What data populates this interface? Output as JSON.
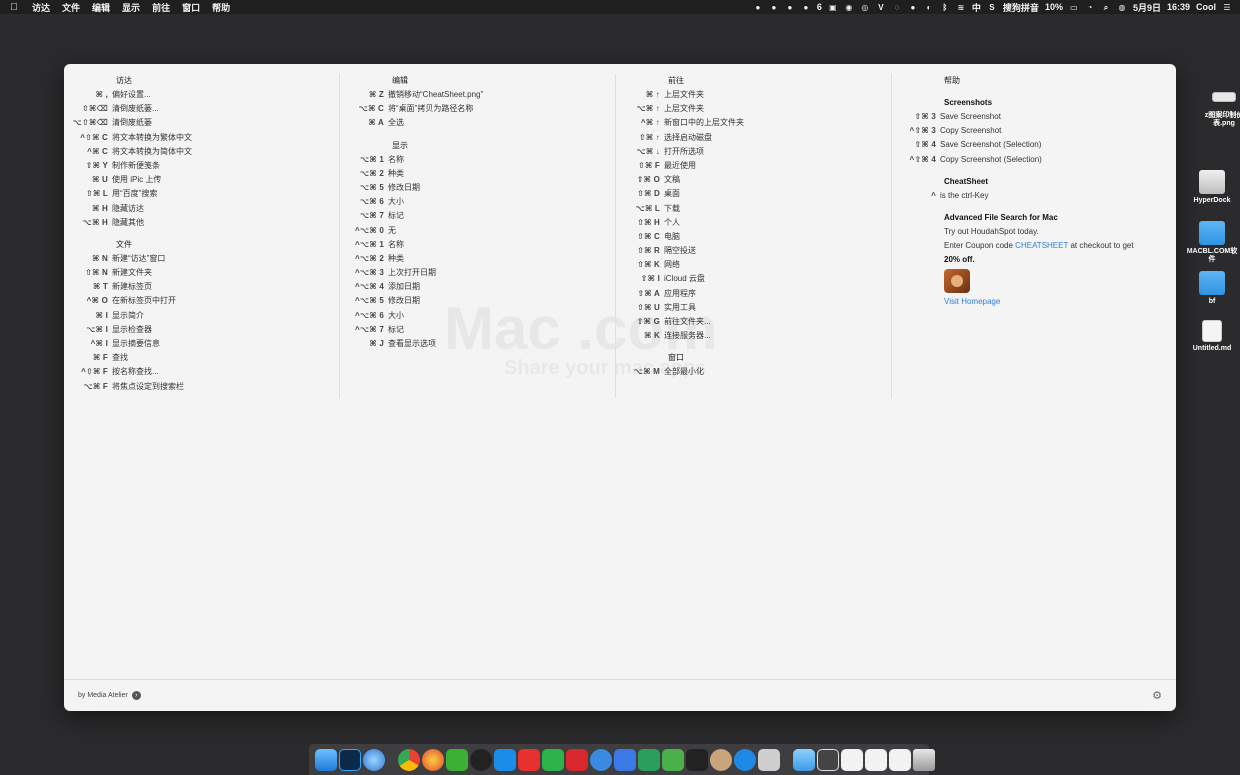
{
  "menubar": {
    "app_name": "访达",
    "menus": [
      "文件",
      "编辑",
      "显示",
      "前往",
      "窗口",
      "帮助"
    ],
    "notification_count": "6",
    "input_method_char": "中",
    "input_method_name": "搜狗拼音",
    "battery": "10%",
    "date": "5月9日",
    "time": "16:39",
    "user": "Cool"
  },
  "desktop_icons": [
    {
      "label": "z图案印制价表.png",
      "type": "png"
    },
    {
      "label": "HyperDock",
      "type": "drive"
    },
    {
      "label": "MACBL.COM软件",
      "type": "folder"
    },
    {
      "label": "bf",
      "type": "folder"
    },
    {
      "label": "Untitled.md",
      "type": "file"
    }
  ],
  "watermark": {
    "main": "Mac   .com",
    "sub": "Share your          mac apps"
  },
  "columns": {
    "finder": {
      "title": "访达",
      "items": [
        {
          "keys": "⌘ ,",
          "label": "偏好设置..."
        },
        {
          "keys": "⇧⌘⌫",
          "label": "清倒废纸篓..."
        },
        {
          "keys": "⌥⇧⌘⌫",
          "label": "清倒废纸篓"
        },
        {
          "keys": "^⇧⌘ C",
          "label": "将文本转换为繁体中文"
        },
        {
          "keys": "^⌘ C",
          "label": "将文本转换为简体中文"
        },
        {
          "keys": "⇧⌘ Y",
          "label": "制作新便笺条"
        },
        {
          "keys": "⌘ U",
          "label": "使用 iPic 上传"
        },
        {
          "keys": "⇧⌘ L",
          "label": "用“百度”搜索"
        },
        {
          "keys": "⌘ H",
          "label": "隐藏访达"
        },
        {
          "keys": "⌥⌘ H",
          "label": "隐藏其他"
        }
      ],
      "file_title": "文件",
      "file_items": [
        {
          "keys": "⌘ N",
          "label": "新建“访达”窗口"
        },
        {
          "keys": "⇧⌘ N",
          "label": "新建文件夹"
        },
        {
          "keys": "⌘ T",
          "label": "新建标签页"
        },
        {
          "keys": "^⌘ O",
          "label": "在新标签页中打开"
        },
        {
          "keys": "⌘ I",
          "label": "显示简介"
        },
        {
          "keys": "⌥⌘ I",
          "label": "显示检查器"
        },
        {
          "keys": "^⌘ I",
          "label": "显示摘要信息"
        },
        {
          "keys": "⌘ F",
          "label": "查找"
        },
        {
          "keys": "^⇧⌘ F",
          "label": "按名称查找..."
        },
        {
          "keys": "⌥⌘ F",
          "label": "将焦点设定到搜索栏"
        }
      ]
    },
    "edit": {
      "title": "编辑",
      "items": [
        {
          "keys": "⌘ Z",
          "label": "撤销移动“CheatSheet.png”"
        },
        {
          "keys": "⌥⌘ C",
          "label": "将“桌面”拷贝为路径名称"
        },
        {
          "keys": "⌘ A",
          "label": "全选"
        }
      ],
      "view_title": "显示",
      "view_items": [
        {
          "keys": "⌥⌘ 1",
          "label": "名称"
        },
        {
          "keys": "⌥⌘ 2",
          "label": "种类"
        },
        {
          "keys": "⌥⌘ 5",
          "label": "修改日期"
        },
        {
          "keys": "⌥⌘ 6",
          "label": "大小"
        },
        {
          "keys": "⌥⌘ 7",
          "label": "标记"
        },
        {
          "keys": "^⌥⌘ 0",
          "label": "无"
        },
        {
          "keys": "^⌥⌘ 1",
          "label": "名称"
        },
        {
          "keys": "^⌥⌘ 2",
          "label": "种类"
        },
        {
          "keys": "^⌥⌘ 3",
          "label": "上次打开日期"
        },
        {
          "keys": "^⌥⌘ 4",
          "label": "添加日期"
        },
        {
          "keys": "^⌥⌘ 5",
          "label": "修改日期"
        },
        {
          "keys": "^⌥⌘ 6",
          "label": "大小"
        },
        {
          "keys": "^⌥⌘ 7",
          "label": "标记"
        },
        {
          "keys": "⌘ J",
          "label": "查看显示选项"
        }
      ]
    },
    "go": {
      "title": "前往",
      "items": [
        {
          "keys": "⌘ ↑",
          "label": "上层文件夹"
        },
        {
          "keys": "⌥⌘ ↑",
          "label": "上层文件夹"
        },
        {
          "keys": "^⌘ ↑",
          "label": "新窗口中的上层文件夹"
        },
        {
          "keys": "⇧⌘ ↑",
          "label": "选择启动磁盘"
        },
        {
          "keys": "⌥⌘ ↓",
          "label": "打开所选项"
        },
        {
          "keys": "⇧⌘ F",
          "label": "最近使用"
        },
        {
          "keys": "⇧⌘ O",
          "label": "文稿"
        },
        {
          "keys": "⇧⌘ D",
          "label": "桌面"
        },
        {
          "keys": "⌥⌘ L",
          "label": "下载"
        },
        {
          "keys": "⇧⌘ H",
          "label": "个人"
        },
        {
          "keys": "⇧⌘ C",
          "label": "电脑"
        },
        {
          "keys": "⇧⌘ R",
          "label": "隔空投送"
        },
        {
          "keys": "⇧⌘ K",
          "label": "网络"
        },
        {
          "keys": "⇧⌘ I",
          "label": "iCloud 云盘"
        },
        {
          "keys": "⇧⌘ A",
          "label": "应用程序"
        },
        {
          "keys": "⇧⌘ U",
          "label": "实用工具"
        },
        {
          "keys": "⇧⌘ G",
          "label": "前往文件夹..."
        },
        {
          "keys": "⌘ K",
          "label": "连接服务器..."
        }
      ],
      "window_title": "窗口",
      "window_items": [
        {
          "keys": "⌥⌘ M",
          "label": "全部最小化"
        }
      ]
    },
    "help": {
      "title": "帮助",
      "screenshots_title": "Screenshots",
      "screenshot_items": [
        {
          "keys": "⇧⌘ 3",
          "label": "Save Screenshot"
        },
        {
          "keys": "^⇧⌘ 3",
          "label": "Copy Screenshot"
        },
        {
          "keys": "⇧⌘ 4",
          "label": "Save Screenshot (Selection)"
        },
        {
          "keys": "^⇧⌘ 4",
          "label": "Copy Screenshot (Selection)"
        }
      ],
      "cheatsheet_title": "CheatSheet",
      "cheatsheet_key": "^",
      "cheatsheet_desc": "is the ctrl-Key",
      "ad_title": "Advanced File Search for Mac",
      "ad_line1": "Try out HoudahSpot today.",
      "ad_line2_prefix": "Enter Coupon code ",
      "ad_coupon": "CHEATSHEET",
      "ad_line2_suffix": " at checkout to get",
      "ad_discount": "20% off.",
      "ad_link": "Visit Homepage"
    }
  },
  "footer": {
    "credit": "by Media Atelier"
  },
  "colors": {
    "panel_bg": "#f4f4f5",
    "link": "#2f7fd6",
    "desktop": "#2b2b2d"
  }
}
